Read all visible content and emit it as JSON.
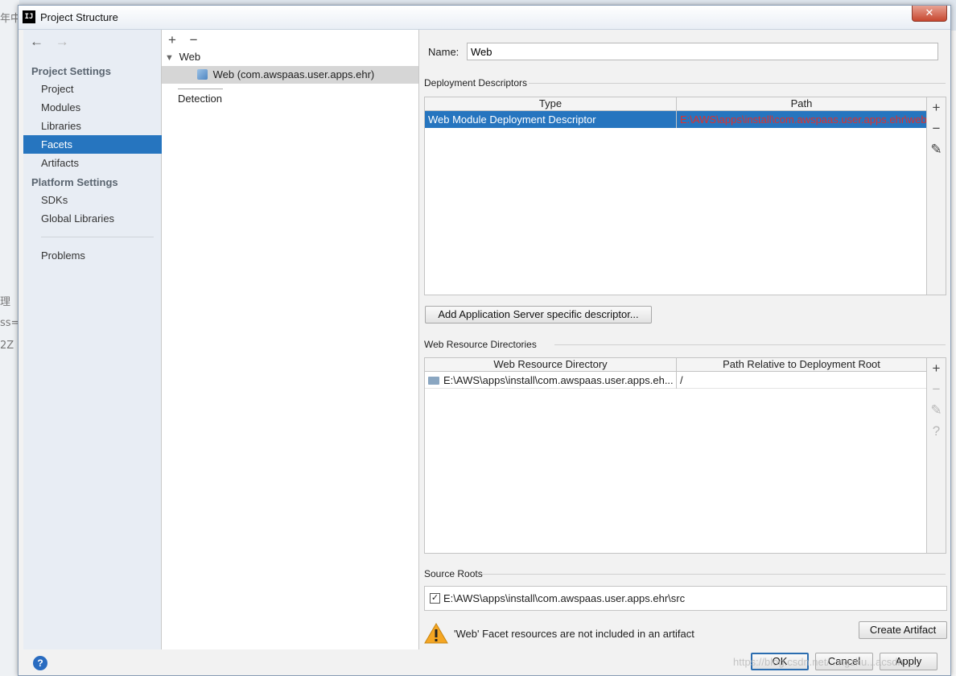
{
  "background": {
    "fragments": [
      "年中",
      "理",
      "ss=",
      "2Z"
    ]
  },
  "window": {
    "title": "Project Structure",
    "close_icon": "close-icon",
    "app_icon_text": "IJ"
  },
  "sidebar": {
    "back_icon": "←",
    "forward_icon": "→",
    "project_settings": "Project Settings",
    "platform_settings": "Platform Settings",
    "items": [
      {
        "label": "Project"
      },
      {
        "label": "Modules"
      },
      {
        "label": "Libraries"
      },
      {
        "label": "Facets",
        "selected": true
      },
      {
        "label": "Artifacts"
      },
      {
        "label": "SDKs"
      },
      {
        "label": "Global Libraries"
      },
      {
        "label": "Problems"
      }
    ]
  },
  "middle": {
    "add": "+",
    "remove": "−",
    "tree": {
      "root": "Web",
      "child": "Web (com.awspaas.user.apps.ehr)",
      "detection": "Detection"
    }
  },
  "facet": {
    "name_label": "Name:",
    "name_value": "Web",
    "deployment_descriptors": {
      "title": "Deployment Descriptors",
      "columns": [
        "Type",
        "Path"
      ],
      "rows": [
        {
          "type": "Web Module Deployment Descriptor",
          "path": "E:\\AWS\\apps\\install\\com.awspaas.user.apps.ehr\\web"
        }
      ],
      "tools": [
        "+",
        "−",
        "✎"
      ]
    },
    "add_server_descriptor": "Add Application Server specific descriptor...",
    "web_resource_dirs": {
      "title": "Web Resource Directories",
      "columns": [
        "Web Resource Directory",
        "Path Relative to Deployment Root"
      ],
      "rows": [
        {
          "dir": "E:\\AWS\\apps\\install\\com.awspaas.user.apps.eh...",
          "relative": "/"
        }
      ],
      "tools": [
        "+",
        "−",
        "✎",
        "?"
      ]
    },
    "source_roots": {
      "title": "Source Roots",
      "checked": true,
      "path": "E:\\AWS\\apps\\install\\com.awspaas.user.apps.ehr\\src"
    },
    "warning": "'Web' Facet resources are not included in an artifact",
    "create_artifact": "Create Artifact"
  },
  "footer": {
    "help": "?",
    "ok": "OK",
    "cancel": "Cancel",
    "apply": "Apply",
    "watermark": "https://blog.csdn.net/...ngzhu...acsdn"
  },
  "colors": {
    "selection": "#2675bf",
    "error_path": "#e0302a",
    "warning": "#f5a623"
  }
}
